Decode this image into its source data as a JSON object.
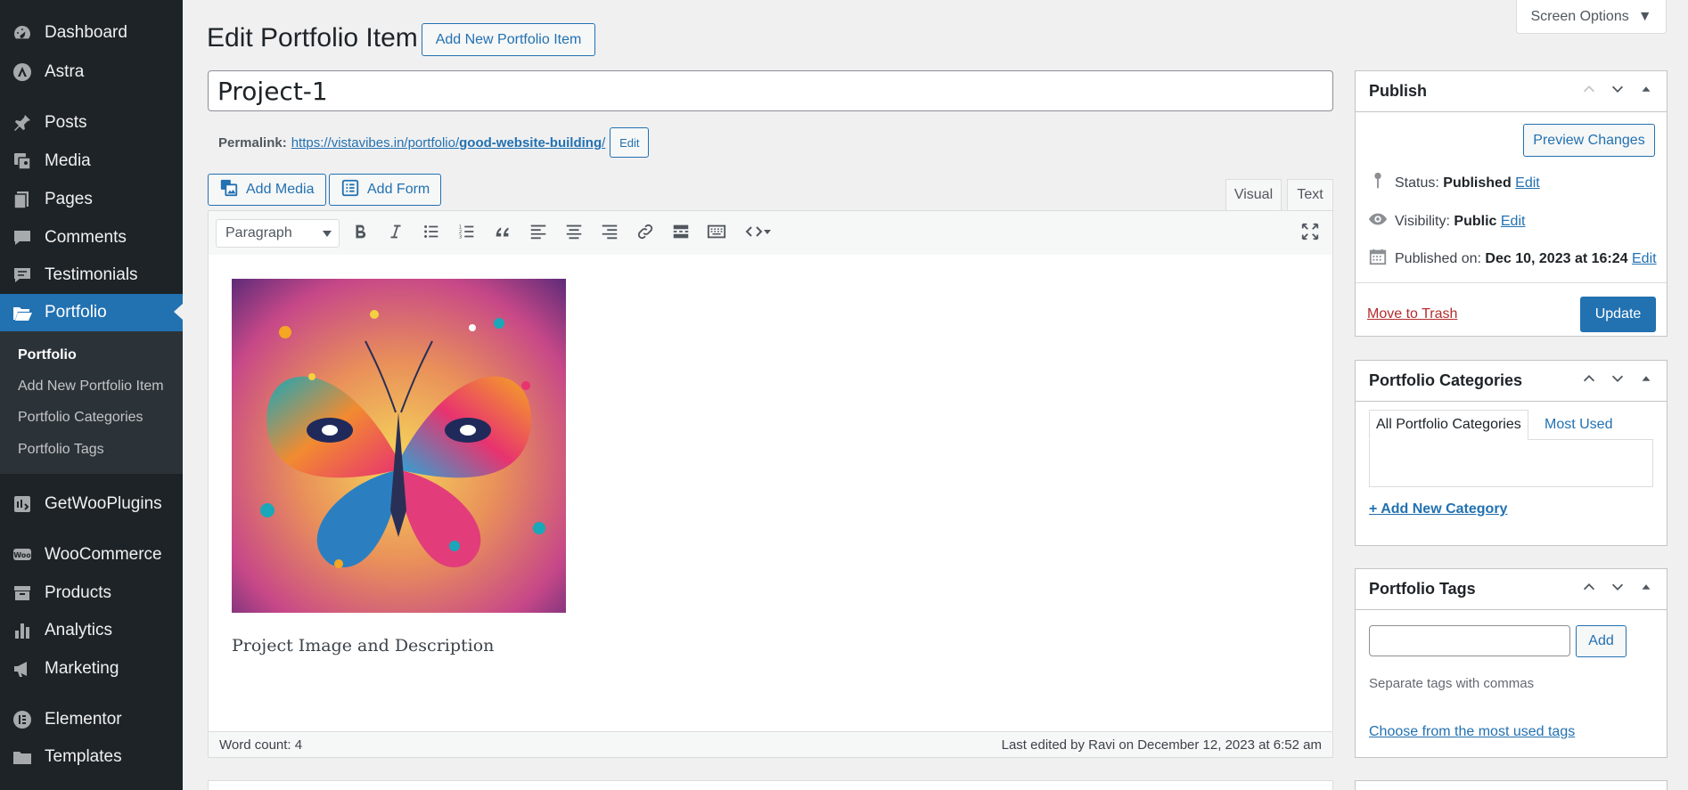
{
  "sidebar": {
    "items": [
      {
        "label": "Dashboard",
        "icon": "dashboard-icon"
      },
      {
        "label": "Astra",
        "icon": "astra-icon"
      },
      {
        "label": "Posts",
        "icon": "pin-icon"
      },
      {
        "label": "Media",
        "icon": "media-icon"
      },
      {
        "label": "Pages",
        "icon": "pages-icon"
      },
      {
        "label": "Comments",
        "icon": "comment-icon"
      },
      {
        "label": "Testimonials",
        "icon": "testimonial-icon"
      },
      {
        "label": "Portfolio",
        "icon": "folder-icon"
      },
      {
        "label": "GetWooPlugins",
        "icon": "plugin-icon"
      },
      {
        "label": "WooCommerce",
        "icon": "woo-icon"
      },
      {
        "label": "Products",
        "icon": "archive-icon"
      },
      {
        "label": "Analytics",
        "icon": "bar-chart-icon"
      },
      {
        "label": "Marketing",
        "icon": "megaphone-icon"
      },
      {
        "label": "Elementor",
        "icon": "elementor-icon"
      },
      {
        "label": "Templates",
        "icon": "folder-icon"
      }
    ],
    "submenu": [
      "Portfolio",
      "Add New Portfolio Item",
      "Portfolio Categories",
      "Portfolio Tags"
    ]
  },
  "header": {
    "title": "Edit Portfolio Item",
    "add_new_label": "Add New Portfolio Item",
    "screen_options_label": "Screen Options"
  },
  "post": {
    "title": "Project-1",
    "permalink_label": "Permalink:",
    "permalink_base": "https://vistavibes.in/portfolio/",
    "permalink_slug": "good-website-building",
    "permalink_trail": "/",
    "permalink_edit_label": "Edit"
  },
  "editor": {
    "add_media_label": "Add Media",
    "add_form_label": "Add Form",
    "tab_visual": "Visual",
    "tab_text": "Text",
    "format_value": "Paragraph",
    "body_text": "Project Image and Description",
    "word_count": "Word count: 4",
    "last_edited": "Last edited by Ravi on December 12, 2023 at 6:52 am"
  },
  "publish": {
    "title": "Publish",
    "preview_label": "Preview Changes",
    "status_label": "Status:",
    "status_value": "Published",
    "visibility_label": "Visibility:",
    "visibility_value": "Public",
    "published_label": "Published on:",
    "published_value": "Dec 10, 2023 at 16:24",
    "edit_label": "Edit",
    "trash_label": "Move to Trash",
    "update_label": "Update"
  },
  "categories": {
    "title": "Portfolio Categories",
    "tab_all": "All Portfolio Categories",
    "tab_most_used": "Most Used",
    "add_new_label": "+ Add New Category"
  },
  "tags": {
    "title": "Portfolio Tags",
    "add_label": "Add",
    "hint": "Separate tags with commas",
    "choose_label": "Choose from the most used tags"
  },
  "colors": {
    "admin_bar": "#1d2327",
    "accent": "#2271b1",
    "danger": "#b32d2e"
  }
}
